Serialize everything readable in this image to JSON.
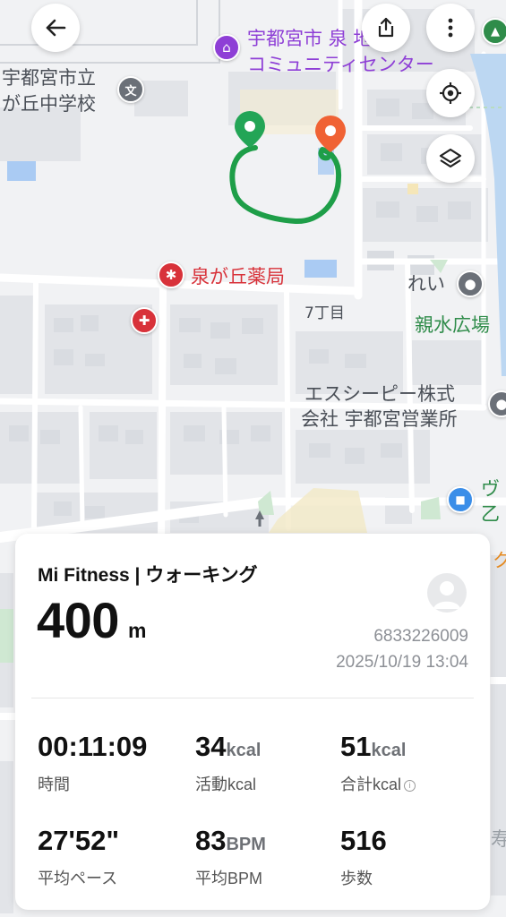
{
  "map": {
    "labels": {
      "community_center_l1": "宇都宮市 泉 地",
      "community_center_l2": "コミュニティセンター",
      "school_l1": "宇都宮市立",
      "school_l2": "が丘中学校",
      "pharmacy": "泉が丘薬局",
      "block": "7丁目",
      "rei": "れい",
      "park": "親水広場",
      "company_l1": "エスシーピー株式",
      "company_l2": "会社 宇都宮営業所",
      "partial_v": "ヴ",
      "partial_otsu": "乙",
      "partial_ku": "ク",
      "partial_kotobuki": "寿"
    },
    "icons": {
      "start": "green-pin-icon",
      "end": "orange-pin-icon",
      "community": "building-icon",
      "school": "school-icon",
      "pharmacy": "pharmacy-icon",
      "clinic": "medical-cross-icon",
      "rei": "place-icon",
      "company": "place-icon",
      "tree": "tree-icon",
      "lock": "lock-icon"
    },
    "colors": {
      "route": "#1e9e48",
      "start_pin": "#23a556",
      "end_pin": "#f06234",
      "purple": "#8e3fd6",
      "red": "#d8323a",
      "green": "#2f8c4a"
    }
  },
  "toolbar": {
    "back_icon": "back-arrow-icon",
    "share_icon": "share-icon",
    "more_icon": "more-vertical-icon",
    "locate_icon": "locate-icon",
    "layers_icon": "layers-icon"
  },
  "card": {
    "app_title": "Mi Fitness | ウォーキング",
    "distance_value": "400",
    "distance_unit": "m",
    "avatar_icon": "avatar-icon",
    "user_id": "6833226009",
    "datetime": "2025/10/19 13:04",
    "stats": [
      {
        "value": "00:11:09",
        "unit": "",
        "label": "時間"
      },
      {
        "value": "34",
        "unit": "kcal",
        "label": "活動kcal"
      },
      {
        "value": "51",
        "unit": "kcal",
        "label": "合計kcal"
      },
      {
        "value": "27'52\"",
        "unit": "",
        "label": "平均ペース"
      },
      {
        "value": "83",
        "unit": "BPM",
        "label": "平均BPM"
      },
      {
        "value": "516",
        "unit": "",
        "label": "歩数"
      }
    ]
  }
}
